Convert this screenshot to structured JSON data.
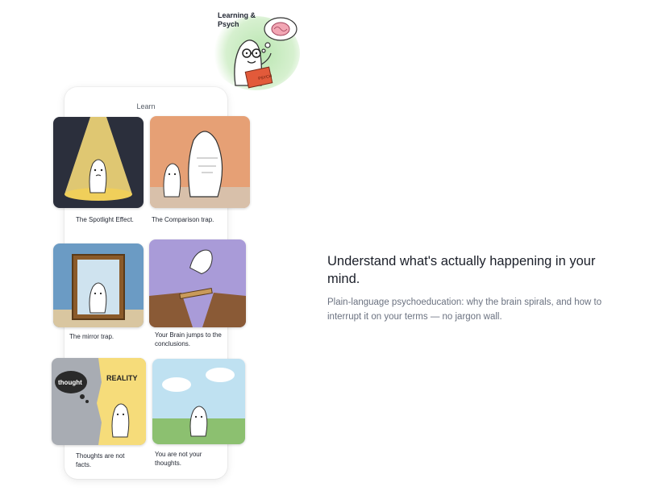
{
  "badge": {
    "label": "Learning & Psych",
    "book_text": "PSYCH"
  },
  "card": {
    "title": "Learn",
    "tiles": [
      {
        "caption": "The Spotlight Effect."
      },
      {
        "caption": "The Comparison trap."
      },
      {
        "caption": "The mirror trap."
      },
      {
        "caption": "Your Brain jumps to the conclusions."
      },
      {
        "caption": "Thoughts are not facts.",
        "bubble_text": "thought",
        "reality_text": "REALITY"
      },
      {
        "caption": "You are not your thoughts."
      }
    ]
  },
  "feature": {
    "headline": "Understand what's actually happening in your mind.",
    "description": "Plain-language psychoeducation: why the brain spirals, and how to interrupt it on your terms — no jargon wall."
  }
}
